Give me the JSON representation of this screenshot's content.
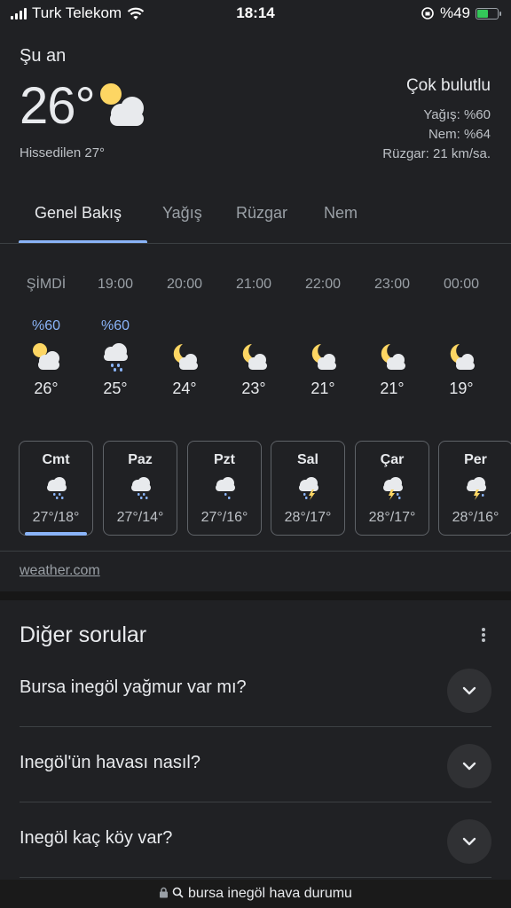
{
  "status_bar": {
    "carrier": "Turk Telekom",
    "time": "18:14",
    "battery": "%49"
  },
  "current": {
    "label": "Şu an",
    "temperature": "26°",
    "feels_like": "Hissedilen 27°",
    "condition": "Çok bulutlu",
    "precipitation": "Yağış: %60",
    "humidity": "Nem: %64",
    "wind": "Rüzgar: 21 km/sa."
  },
  "tabs": [
    {
      "label": "Genel Bakış",
      "active": true
    },
    {
      "label": "Yağış",
      "active": false
    },
    {
      "label": "Rüzgar",
      "active": false
    },
    {
      "label": "Nem",
      "active": false
    }
  ],
  "hourly": [
    {
      "hour": "ŞİMDİ",
      "precip": "%60",
      "icon": "partly-cloudy-day-icon",
      "temp": "26°"
    },
    {
      "hour": "19:00",
      "precip": "%60",
      "icon": "rain-icon",
      "temp": "25°"
    },
    {
      "hour": "20:00",
      "precip": "",
      "icon": "partly-cloudy-night-icon",
      "temp": "24°"
    },
    {
      "hour": "21:00",
      "precip": "",
      "icon": "partly-cloudy-night-icon",
      "temp": "23°"
    },
    {
      "hour": "22:00",
      "precip": "",
      "icon": "partly-cloudy-night-icon",
      "temp": "21°"
    },
    {
      "hour": "23:00",
      "precip": "",
      "icon": "partly-cloudy-night-icon",
      "temp": "21°"
    },
    {
      "hour": "00:00",
      "precip": "",
      "icon": "partly-cloudy-night-icon",
      "temp": "19°"
    }
  ],
  "daily": [
    {
      "day": "Cmt",
      "icon": "rain-icon",
      "temps": "27°/18°",
      "active": true
    },
    {
      "day": "Paz",
      "icon": "rain-icon",
      "temps": "27°/14°",
      "active": false
    },
    {
      "day": "Pzt",
      "icon": "rain-icon",
      "temps": "27°/16°",
      "active": false
    },
    {
      "day": "Sal",
      "icon": "thunderstorm-rain-icon",
      "temps": "28°/17°",
      "active": false
    },
    {
      "day": "Çar",
      "icon": "thunderstorm-rain-icon",
      "temps": "28°/17°",
      "active": false
    },
    {
      "day": "Per",
      "icon": "thunderstorm-rain-icon",
      "temps": "28°/16°",
      "active": false
    }
  ],
  "source": "weather.com",
  "people_also_ask": {
    "title": "Diğer sorular",
    "questions": [
      "Bursa inegöl yağmur var mı?",
      "Inegöl'ün havası nasıl?",
      "Inegöl kaç köy var?"
    ]
  },
  "url_bar": {
    "text": "bursa inegöl hava durumu"
  },
  "colors": {
    "background": "#202124",
    "accent": "#8ab4f8",
    "sun": "#fdd663",
    "cloud": "#e8eaed"
  }
}
